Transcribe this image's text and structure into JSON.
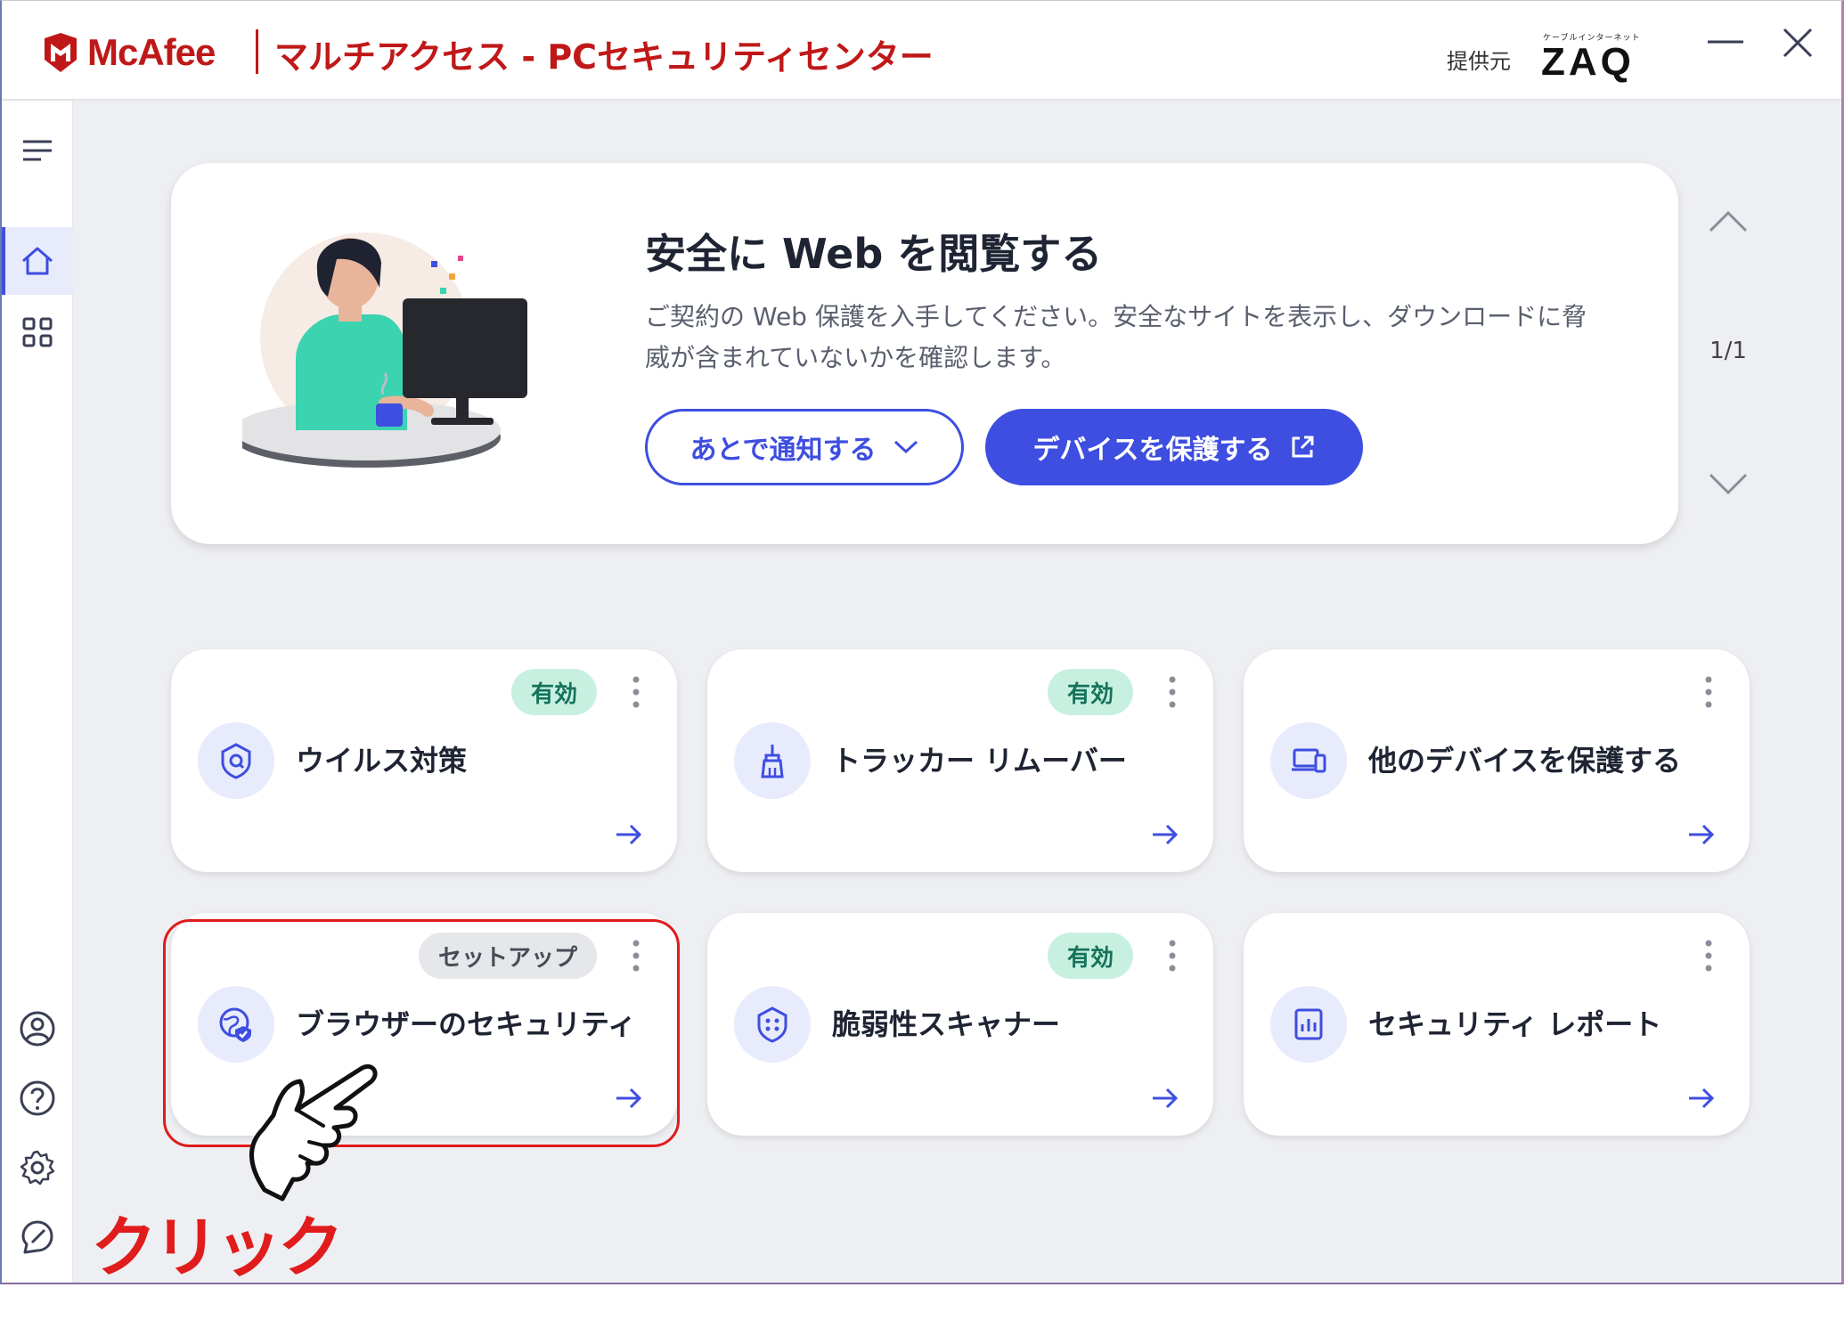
{
  "window": {
    "brand": "McAfee",
    "app_title": "マルチアクセス - PCセキュリティセンター",
    "provider_label": "提供元",
    "provider_small": "ケーブルインターネット",
    "provider_name": "ZAQ"
  },
  "sidebar": {
    "top_items": [
      "menu-icon",
      "home-icon",
      "apps-grid-icon"
    ],
    "bottom_items": [
      "account-icon",
      "help-icon",
      "settings-icon",
      "feedback-icon"
    ],
    "active": "home"
  },
  "banner": {
    "title": "安全に Web を閲覧する",
    "description": "ご契約の Web 保護を入手してください。安全なサイトを表示し、ダウンロードに脅威が含まれていないかを確認します。",
    "secondary_button": "あとで通知する",
    "primary_button": "デバイスを保護する",
    "pager": "1/1"
  },
  "cards": [
    {
      "title": "ウイルス対策",
      "badge": "有効",
      "badge_type": "active",
      "icon": "shield-scan-icon"
    },
    {
      "title": "トラッカー リムーバー",
      "badge": "有効",
      "badge_type": "active",
      "icon": "broom-icon"
    },
    {
      "title": "他のデバイスを保護する",
      "badge": "",
      "badge_type": "none",
      "icon": "devices-icon"
    },
    {
      "title": "ブラウザーのセキュリティ",
      "badge": "セットアップ",
      "badge_type": "setup",
      "icon": "browser-globe-shield-icon"
    },
    {
      "title": "脆弱性スキャナー",
      "badge": "有効",
      "badge_type": "active",
      "icon": "vulnerability-scan-icon"
    },
    {
      "title": "セキュリティ レポート",
      "badge": "",
      "badge_type": "none",
      "icon": "report-chart-icon"
    }
  ],
  "annotation": {
    "label": "クリック",
    "color": "#e01c1c"
  },
  "colors": {
    "brand_red": "#c01818",
    "accent_blue": "#3e4ee0",
    "active_badge_bg": "#c8f0e1",
    "active_badge_text": "#15735a"
  }
}
